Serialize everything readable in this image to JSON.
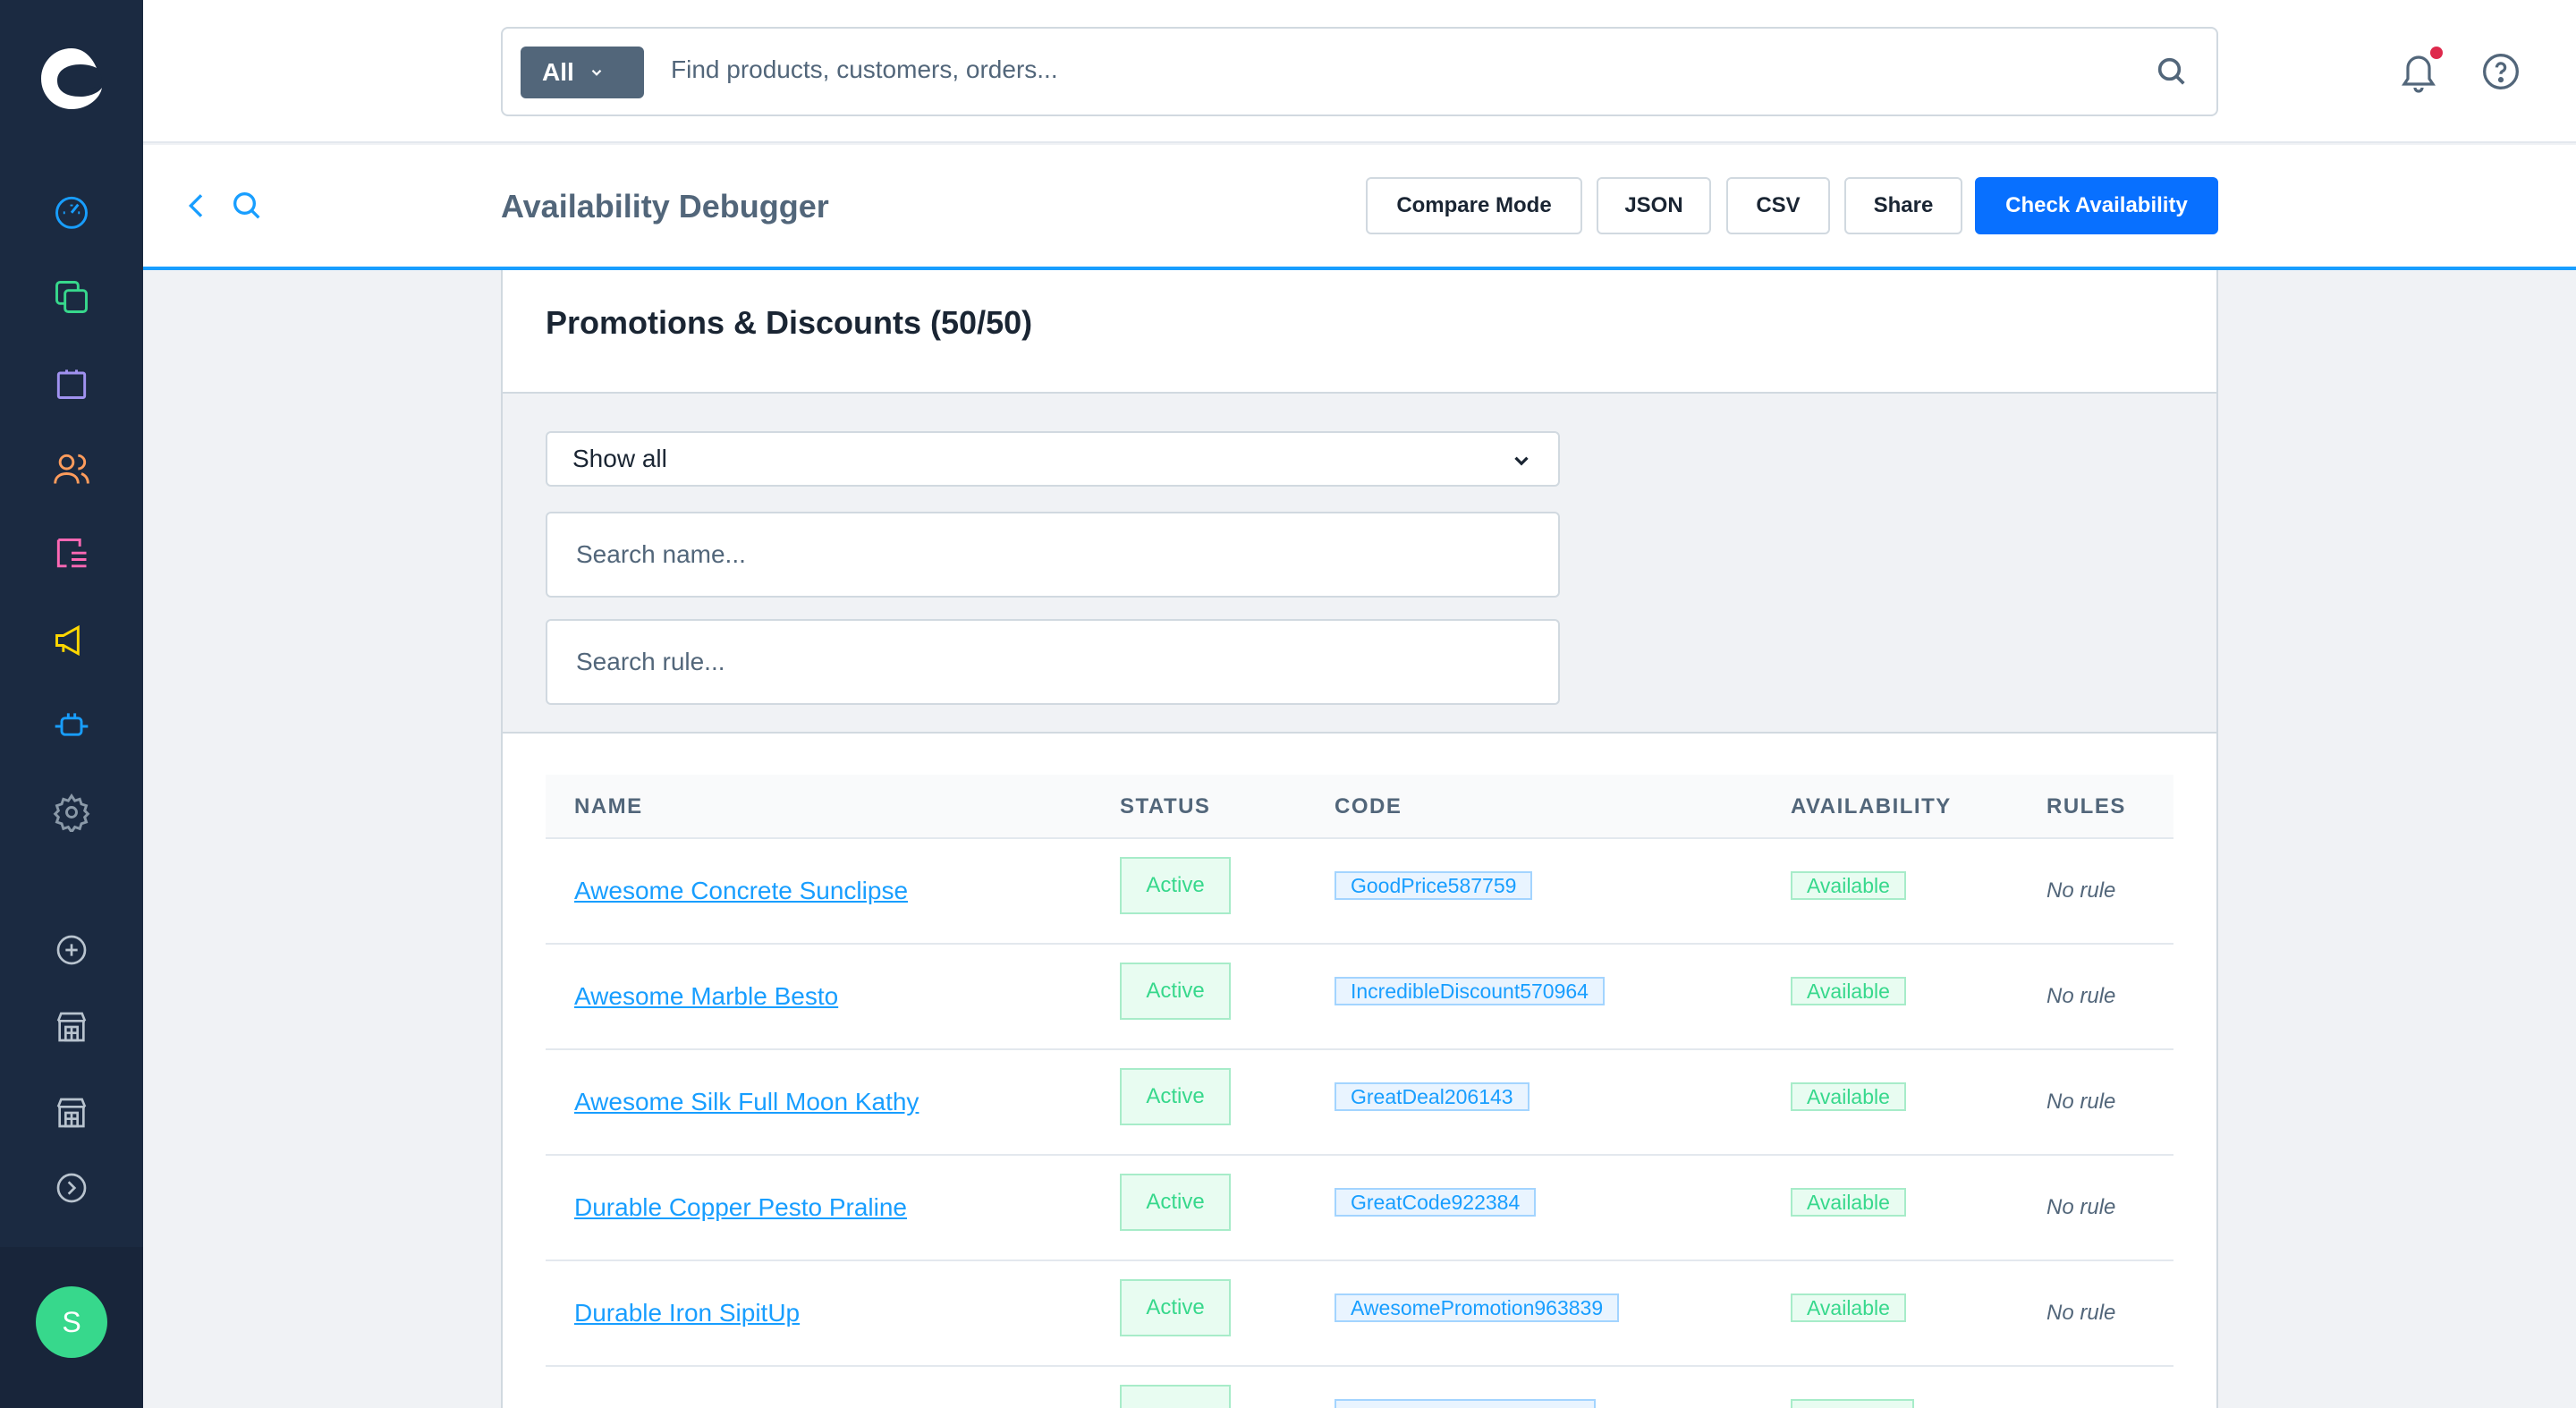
{
  "header": {
    "search_type": "All",
    "search_placeholder": "Find products, customers, orders..."
  },
  "subbar": {
    "title": "Availability Debugger",
    "buttons": {
      "compare": "Compare Mode",
      "json": "JSON",
      "csv": "CSV",
      "share": "Share",
      "check": "Check Availability"
    }
  },
  "card": {
    "title": "Promotions & Discounts (50/50)",
    "filter_select": "Show all",
    "search_name_placeholder": "Search name...",
    "search_rule_placeholder": "Search rule..."
  },
  "table": {
    "headers": {
      "name": "NAME",
      "status": "STATUS",
      "code": "CODE",
      "availability": "AVAILABILITY",
      "rules": "RULES"
    },
    "rows": [
      {
        "name": "Awesome Concrete Sunclipse",
        "status": "Active",
        "code": "GoodPrice587759",
        "availability": "Available",
        "rules": "No rule"
      },
      {
        "name": "Awesome Marble Besto",
        "status": "Active",
        "code": "IncredibleDiscount570964",
        "availability": "Available",
        "rules": "No rule"
      },
      {
        "name": "Awesome Silk Full Moon Kathy",
        "status": "Active",
        "code": "GreatDeal206143",
        "availability": "Available",
        "rules": "No rule"
      },
      {
        "name": "Durable Copper Pesto Praline",
        "status": "Active",
        "code": "GreatCode922384",
        "availability": "Available",
        "rules": "No rule"
      },
      {
        "name": "Durable Iron SipitUp",
        "status": "Active",
        "code": "AwesomePromotion963839",
        "availability": "Available",
        "rules": "No rule"
      }
    ]
  },
  "user": {
    "initial": "S"
  },
  "colors": {
    "sidebar": "#1b2a41",
    "primary": "#0870ff",
    "accent": "#189eff",
    "success": "#37d88c",
    "notification": "#de294c"
  }
}
